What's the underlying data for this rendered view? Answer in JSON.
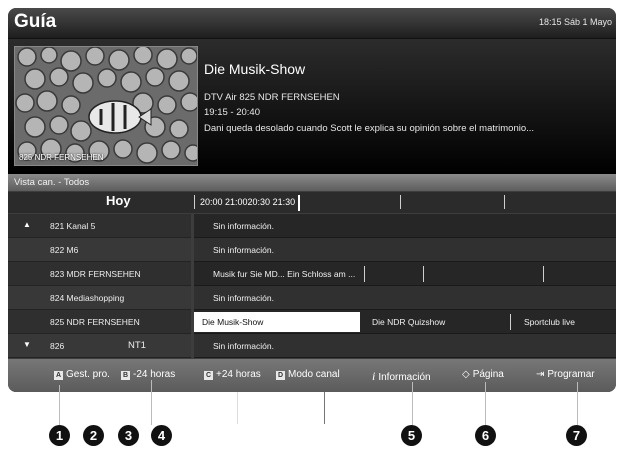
{
  "header": {
    "title": "Guía",
    "clock": "18:15 Sáb 1 Mayo"
  },
  "info": {
    "preview_channel": "825 NDR FERNSEHEN",
    "show_title": "Die Musik-Show",
    "channel_line": "DTV Air 825 NDR FERNSEHEN",
    "time_line": "19:15 - 20:40",
    "description": "Dani queda desolado cuando Scott le explica su opinión sobre el matrimonio..."
  },
  "view": {
    "label": "Vista can. - Todos"
  },
  "timeline": {
    "today": "Hoy",
    "times": "20:00 21:0020:30 21:30"
  },
  "rows": [
    {
      "arrow": "▲",
      "channel": "821 Kanal 5",
      "programs": [
        "Sin información."
      ]
    },
    {
      "channel": "822 M6",
      "programs": [
        "Sin información."
      ]
    },
    {
      "channel": "823 MDR FERNSEHEN",
      "programs": [
        "Musik fur Sie MD... Ein Schloss am ..."
      ]
    },
    {
      "channel": "824 Mediashopping",
      "programs": [
        "Sin información."
      ]
    },
    {
      "channel": "825 NDR FERNSEHEN",
      "programs": [
        "Die Musik-Show",
        "Die NDR Quizshow",
        "Sportclub live"
      ]
    },
    {
      "arrow": "▼",
      "channel": "826",
      "sub": "NT1",
      "programs": [
        "Sin información."
      ]
    }
  ],
  "bottom": {
    "a_key": "A",
    "a_label": "Gest. pro.",
    "b_key": "B",
    "b_label": "-24 horas",
    "c_key": "C",
    "c_label": "+24 horas",
    "d_key": "D",
    "d_label": "Modo canal",
    "info_icon": "i",
    "info_label": "Información",
    "page_icon": "◇",
    "page_label": "Página",
    "prog_icon": "⇥",
    "prog_label": "Programar"
  },
  "badges": [
    "1",
    "2",
    "3",
    "4",
    "5",
    "6",
    "7"
  ],
  "icons": {
    "up": "arrow-up-icon",
    "down": "arrow-down-icon",
    "info": "info-icon",
    "page": "page-updown-icon",
    "schedule": "schedule-icon"
  },
  "colors": {
    "selected_bg": "#ffffff",
    "bar_bg": "#6a6a6a",
    "badge_bg": "#111111"
  }
}
